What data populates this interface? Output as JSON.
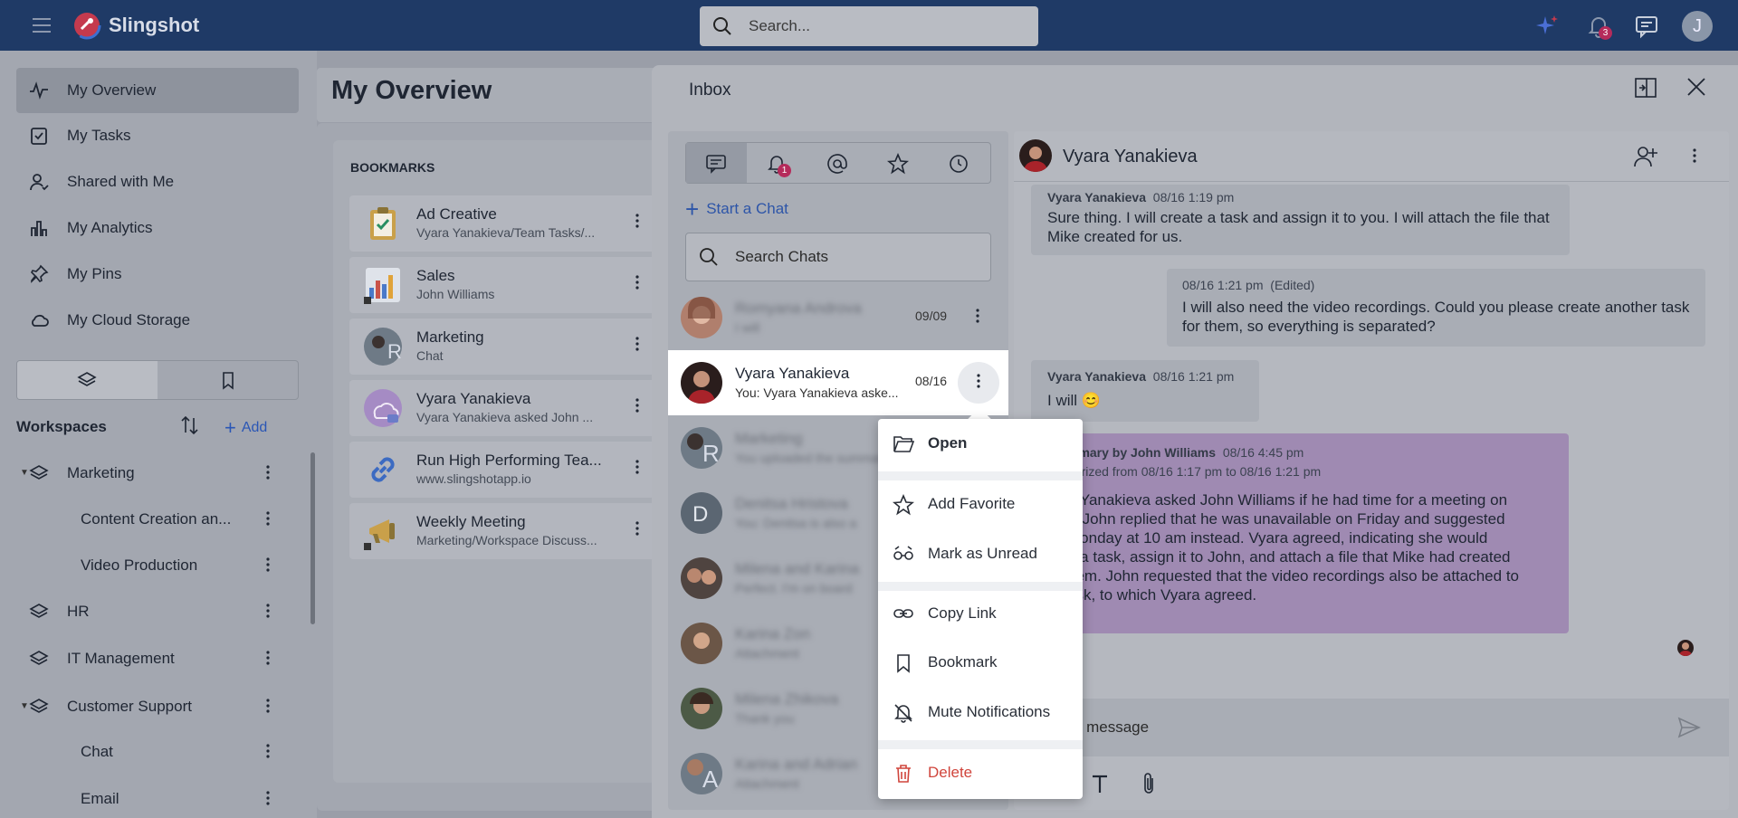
{
  "app": {
    "title": "Slingshot",
    "avatar_initial": "J"
  },
  "search": {
    "placeholder": "Search..."
  },
  "notifications": {
    "count": "3"
  },
  "sidebar": {
    "nav": [
      {
        "label": "My Overview"
      },
      {
        "label": "My Tasks"
      },
      {
        "label": "Shared with Me"
      },
      {
        "label": "My Analytics"
      },
      {
        "label": "My Pins"
      },
      {
        "label": "My Cloud Storage"
      }
    ],
    "workspaces_title": "Workspaces",
    "add_label": "Add",
    "tree": [
      {
        "label": "Marketing"
      },
      {
        "label": "Content Creation an..."
      },
      {
        "label": "Video Production"
      },
      {
        "label": "HR"
      },
      {
        "label": "IT Management"
      },
      {
        "label": "Customer Support"
      },
      {
        "label": "Chat"
      },
      {
        "label": "Email"
      }
    ]
  },
  "main": {
    "title": "My Overview",
    "bookmarks_title": "BOOKMARKS",
    "bookmarks": [
      {
        "title": "Ad Creative",
        "subtitle": "Vyara Yanakieva/Team Tasks/..."
      },
      {
        "title": "Sales",
        "subtitle": "John Williams"
      },
      {
        "title": "Marketing",
        "subtitle": "Chat",
        "initial": "R"
      },
      {
        "title": "Vyara Yanakieva",
        "subtitle": "Vyara Yanakieva asked John ..."
      },
      {
        "title": "Run High Performing Tea...",
        "subtitle": "www.slingshotapp.io"
      },
      {
        "title": "Weekly Meeting",
        "subtitle": "Marketing/Workspace Discuss..."
      }
    ]
  },
  "inbox": {
    "title": "Inbox",
    "tab_badge": "1",
    "start_chat": "Start a Chat",
    "search_placeholder": "Search Chats",
    "chats": [
      {
        "name": "Romyana Androva",
        "preview": "I will",
        "date": "09/09"
      },
      {
        "name": "Vyara Yanakieva",
        "preview": "You: Vyara Yanakieva aske...",
        "date": "08/16"
      },
      {
        "name": "Marketing",
        "preview": "You uploaded the summary",
        "initial": "R"
      },
      {
        "name": "Denitsa Hristova",
        "preview": "You: Denitsa is also a",
        "initial": "D"
      },
      {
        "name": "Milena and Karina",
        "preview": "Perfect. I'm on board"
      },
      {
        "name": "Karina Zon",
        "preview": "Attachment"
      },
      {
        "name": "Milena Zhikova",
        "preview": "Thank you"
      },
      {
        "name": "Karina and Adrian",
        "preview": "Attachment",
        "initial": "A"
      }
    ]
  },
  "conversation": {
    "name": "Vyara Yanakieva",
    "messages": [
      {
        "author": "Vyara Yanakieva",
        "time": "08/16 1:19 pm",
        "text": "Sure thing. I will create a task and assign it to you. I will attach the file that Mike created for us."
      },
      {
        "author": "",
        "time": "08/16 1:21 pm",
        "edited": "(Edited)",
        "text": "I will also need the video recordings. Could you please create another task for them, so everything is separated?"
      },
      {
        "author": "Vyara Yanakieva",
        "time": "08/16 1:21 pm",
        "text": "I will 😊"
      }
    ],
    "summary": {
      "author": "mmary by John Williams",
      "time": "08/16 4:45 pm",
      "range": "narized from 08/16 1:17 pm to 08/16 1:21 pm",
      "lines": [
        "a Yanakieva asked John Williams if he had time for a meeting on",
        "y. John replied that he was unavailable on Friday and suggested",
        "Monday at 10 am instead. Vyara agreed, indicating she would",
        "e a task, assign it to John, and attach a file that Mike had created",
        "hem. John requested that the video recordings also be attached to",
        "ask, to which Vyara agreed."
      ]
    },
    "composer_placeholder": "a new message"
  },
  "context_menu": {
    "items": [
      {
        "label": "Open"
      },
      {
        "label": "Add Favorite"
      },
      {
        "label": "Mark as Unread"
      },
      {
        "label": "Copy Link"
      },
      {
        "label": "Bookmark"
      },
      {
        "label": "Mute Notifications"
      },
      {
        "label": "Delete"
      }
    ]
  },
  "colors": {
    "topbar": "#1f3a66",
    "accent": "#2d55a8",
    "danger": "#d0453c",
    "badge": "#b52b5b",
    "summary": "#9f8ab2"
  }
}
